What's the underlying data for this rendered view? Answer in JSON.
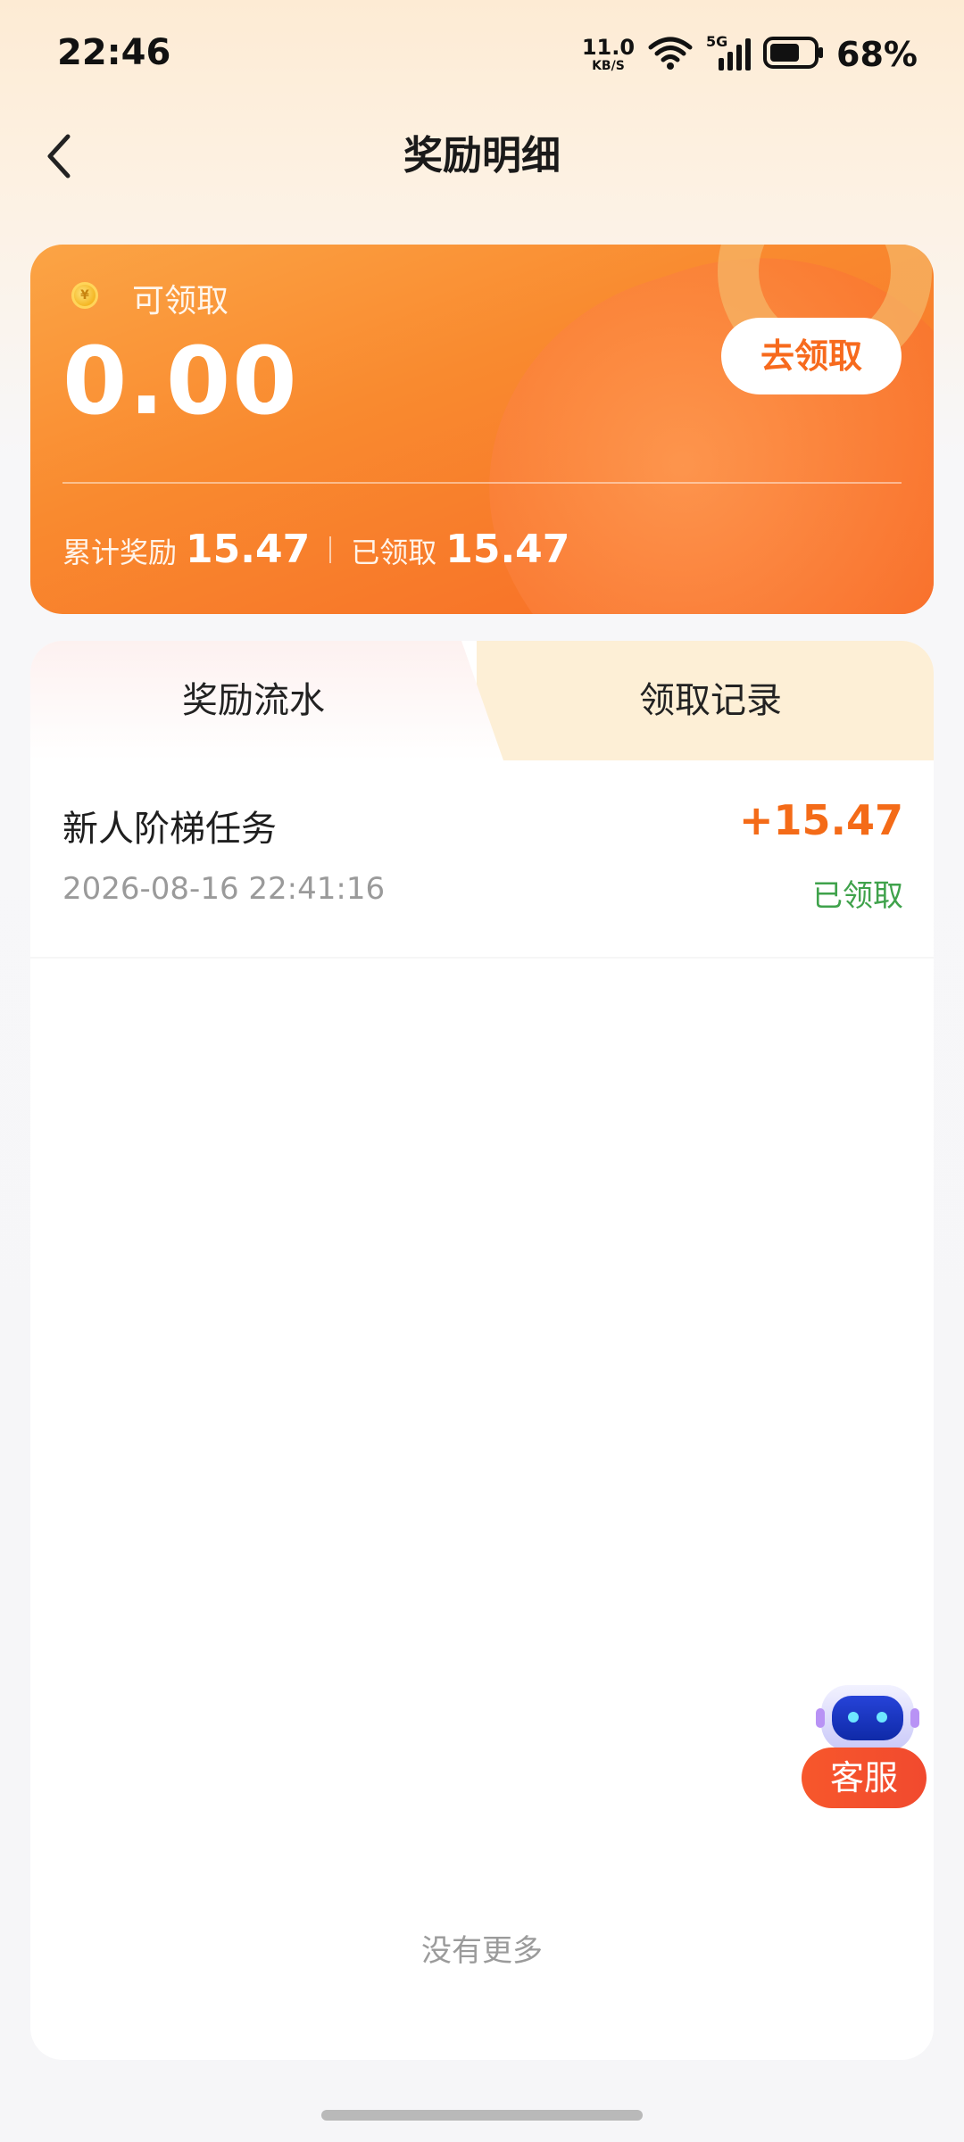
{
  "status_bar": {
    "time": "22:46",
    "net_speed_value": "11.0",
    "net_speed_unit": "KB/S",
    "network_type": "5G",
    "battery_percent": "68%",
    "battery_level": 0.68
  },
  "nav": {
    "title": "奖励明细",
    "back_icon": "chevron-left-icon"
  },
  "reward_card": {
    "claimable_label": "可领取",
    "claimable_amount": "0.00",
    "claim_button": "去领取",
    "total_label": "累计奖励",
    "total_value": "15.47",
    "claimed_label": "已领取",
    "claimed_value": "15.47",
    "coin_icon": "coin-icon"
  },
  "tabs": [
    {
      "label": "奖励流水",
      "active": true
    },
    {
      "label": "领取记录",
      "active": false
    }
  ],
  "records": [
    {
      "title": "新人阶梯任务",
      "amount": "+15.47",
      "time": "2026-08-16 22:41:16",
      "status": "已领取"
    }
  ],
  "footer": {
    "no_more": "没有更多"
  },
  "customer_service": {
    "label": "客服",
    "icon": "robot-icon"
  },
  "colors": {
    "accent": "#f76a1d",
    "amount": "#f46b18",
    "status_success": "#3fa24b",
    "card_gradient_start": "#fba445",
    "card_gradient_end": "#f76925"
  }
}
